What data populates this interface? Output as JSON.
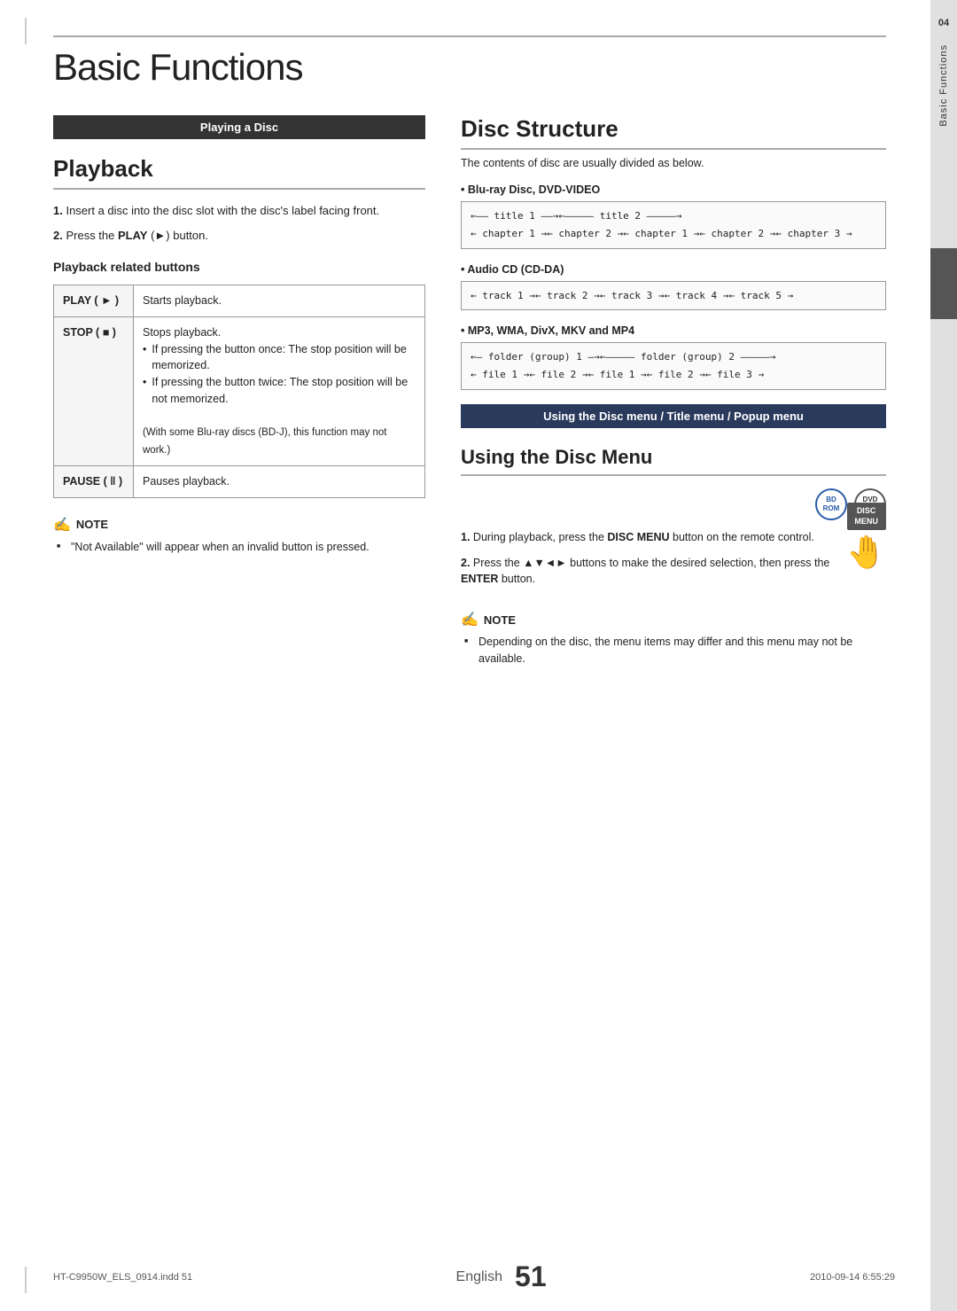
{
  "page": {
    "title": "Basic Functions",
    "side_tab_number": "04",
    "side_tab_label": "Basic Functions"
  },
  "left_column": {
    "section_header": "Playing a Disc",
    "playback": {
      "title": "Playback",
      "step1": "Insert a disc into the disc slot with the disc's label facing front.",
      "step2_prefix": "Press the ",
      "step2_bold": "PLAY",
      "step2_symbol": " (►) button.",
      "related_buttons_title": "Playback related buttons",
      "buttons": [
        {
          "name": "PLAY ( ► )",
          "description": "Starts playback."
        },
        {
          "name": "STOP ( ■ )",
          "description_plain": "Stops playback.",
          "description_bullets": [
            "If pressing the button once: The stop position will be memorized.",
            "If pressing the button twice: The stop position will be not memorized."
          ],
          "description_note": "(With some Blu-ray discs (BD-J), this function may not work.)"
        },
        {
          "name": "PAUSE ( ‖ )",
          "description": "Pauses playback."
        }
      ]
    },
    "note": {
      "title": "NOTE",
      "items": [
        "\"Not Available\" will appear when an invalid button is pressed."
      ]
    }
  },
  "right_column": {
    "disc_structure": {
      "title": "Disc Structure",
      "intro": "The contents of disc are usually divided as below.",
      "types": [
        {
          "label": "Blu-ray Disc, DVD-VIDEO",
          "diagram_lines": [
            "←—— title 1 ——→←————— title 2 ————→",
            "← chapter 1 →← chapter 2 →← chapter 1 →← chapter 2 →← chapter 3 →"
          ]
        },
        {
          "label": "Audio CD (CD-DA)",
          "diagram_lines": [
            "← track 1 →← track 2 →← track 3 →← track 4 →← track 5 →"
          ]
        },
        {
          "label": "MP3, WMA, DivX, MKV and MP4",
          "diagram_lines": [
            "←— folder (group) 1 —→←————— folder (group) 2 ————→",
            "← file 1 →← file 2 →← file 1 →← file 2 →← file 3 →"
          ]
        }
      ]
    },
    "disc_menu_header": "Using the Disc menu / Title menu / Popup menu",
    "using_disc_menu": {
      "title": "Using the Disc Menu",
      "icons": [
        {
          "line1": "BD-ROM",
          "type": "blue"
        },
        {
          "line1": "DVD-VIDEO",
          "type": "normal"
        }
      ],
      "steps": [
        {
          "num": "1.",
          "text_plain": "During playback, press the ",
          "text_bold": "DISC MENU",
          "text_end": " button on the remote control.",
          "button_label": "DISC\nMENU"
        },
        {
          "num": "2.",
          "text_plain": "Press the ▲▼◄► buttons to make the desired selection, then press the ",
          "text_bold": "ENTER",
          "text_end": " button."
        }
      ],
      "note": {
        "title": "NOTE",
        "items": [
          "Depending on the disc, the menu items may differ and this menu may not be available."
        ]
      }
    }
  },
  "footer": {
    "file_info": "HT-C9950W_ELS_0914.indd  51",
    "date_info": "2010-09-14  6:55:29",
    "english_label": "English",
    "page_number": "51"
  }
}
